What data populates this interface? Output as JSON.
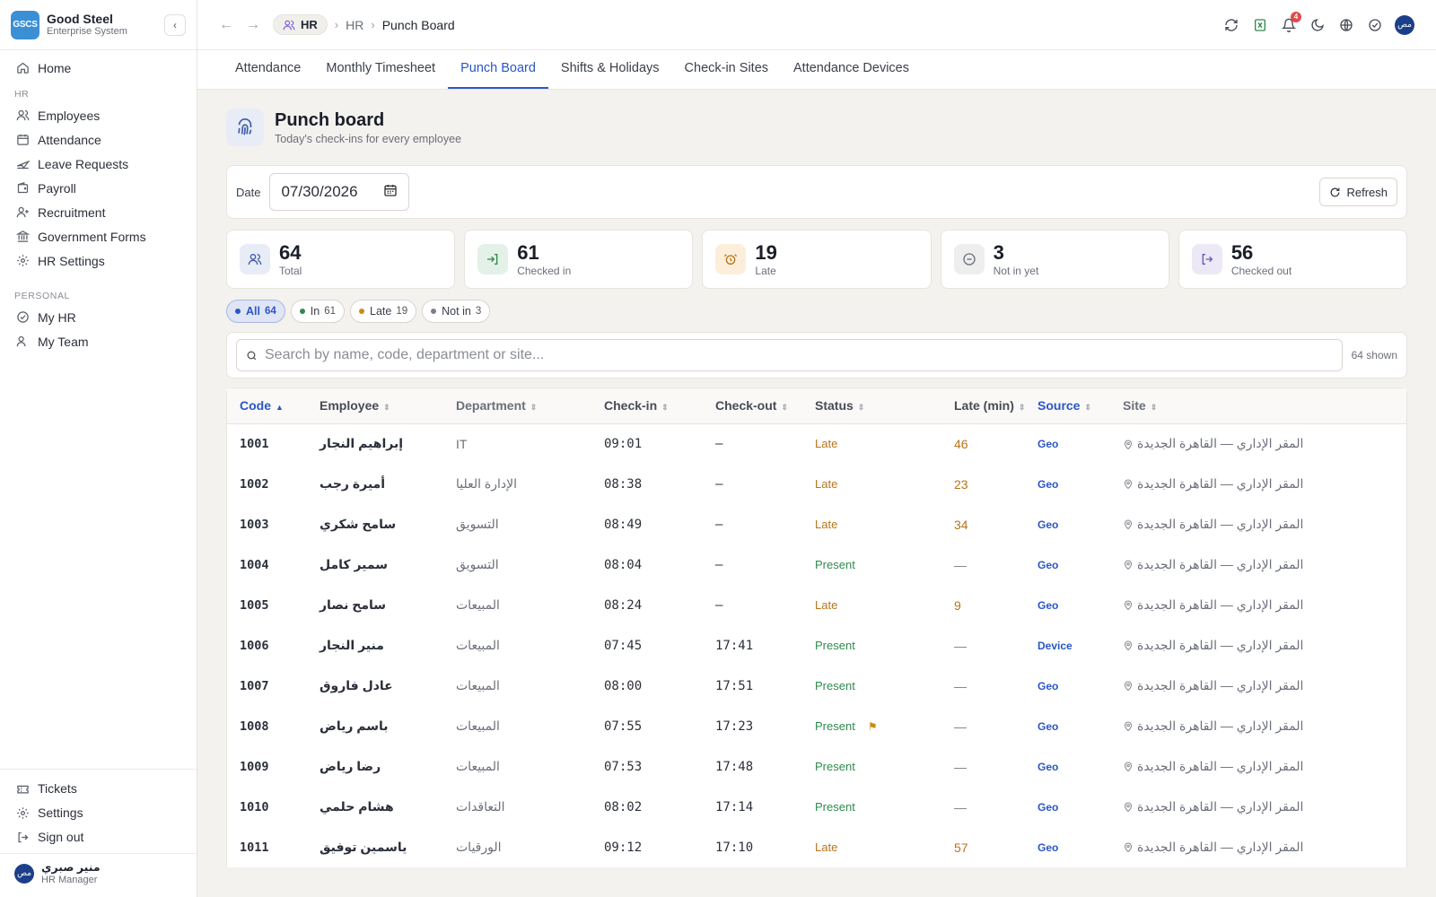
{
  "brand": {
    "logo": "GSCS",
    "name": "Good Steel",
    "subtitle": "Enterprise System"
  },
  "sidebar": {
    "home": "Home",
    "hr_section": "HR",
    "hr_items": [
      {
        "label": "Employees",
        "icon": "users-icon"
      },
      {
        "label": "Attendance",
        "icon": "calendar-icon"
      },
      {
        "label": "Leave Requests",
        "icon": "plane-icon"
      },
      {
        "label": "Payroll",
        "icon": "wallet-icon"
      },
      {
        "label": "Recruitment",
        "icon": "user-plus-icon"
      },
      {
        "label": "Government Forms",
        "icon": "landmark-icon"
      },
      {
        "label": "HR Settings",
        "icon": "gear-icon"
      }
    ],
    "personal_section": "PERSONAL",
    "personal_items": [
      {
        "label": "My HR",
        "icon": "check-circle-icon"
      },
      {
        "label": "My Team",
        "icon": "team-icon"
      }
    ],
    "bottom_items": [
      {
        "label": "Tickets",
        "icon": "ticket-icon"
      },
      {
        "label": "Settings",
        "icon": "gear-icon"
      },
      {
        "label": "Sign out",
        "icon": "sign-out-icon"
      }
    ],
    "user": {
      "initials": "مص",
      "name": "منير صبري",
      "role": "HR Manager"
    }
  },
  "topbar": {
    "module": "HR",
    "breadcrumbs": [
      "HR",
      "Punch Board"
    ],
    "notifications_count": "4",
    "avatar_initials": "مص"
  },
  "tabs": [
    "Attendance",
    "Monthly Timesheet",
    "Punch Board",
    "Shifts & Holidays",
    "Check-in Sites",
    "Attendance Devices"
  ],
  "active_tab": "Punch Board",
  "page": {
    "title": "Punch board",
    "subtitle": "Today's check-ins for every employee"
  },
  "filters": {
    "date_label": "Date",
    "date_value": "07/30/2026",
    "refresh_label": "Refresh"
  },
  "stats": [
    {
      "value": "64",
      "label": "Total",
      "color": "#e8ecf7",
      "fg": "#3c5aa8"
    },
    {
      "value": "61",
      "label": "Checked in",
      "color": "#e3f1e8",
      "fg": "#2f8a4d"
    },
    {
      "value": "19",
      "label": "Late",
      "color": "#fbeedb",
      "fg": "#b8741a"
    },
    {
      "value": "3",
      "label": "Not in yet",
      "color": "#eeeeee",
      "fg": "#6b6f7a"
    },
    {
      "value": "56",
      "label": "Checked out",
      "color": "#ece8f6",
      "fg": "#6b55b8"
    }
  ],
  "chips": [
    {
      "label": "All",
      "count": "64",
      "dot": "#2a56c6"
    },
    {
      "label": "In",
      "count": "61",
      "dot": "#2f8a4d"
    },
    {
      "label": "Late",
      "count": "19",
      "dot": "#c78d12"
    },
    {
      "label": "Not in",
      "count": "3",
      "dot": "#7b7f88"
    }
  ],
  "search": {
    "placeholder": "Search by name, code, department or site...",
    "shown_text": "64 shown"
  },
  "table": {
    "columns": [
      "Code",
      "Employee",
      "Department",
      "Check-in",
      "Check-out",
      "Status",
      "Late (min)",
      "Source",
      "Site"
    ],
    "rows": [
      {
        "code": "1001",
        "employee": "إبراهيم النجار",
        "department": "IT",
        "check_in": "09:01",
        "check_out": "—",
        "status": "Late",
        "late": "46",
        "source": "Geo",
        "site": "المقر الإداري — القاهرة الجديدة",
        "flag": false
      },
      {
        "code": "1002",
        "employee": "أميرة رجب",
        "department": "الإدارة العليا",
        "check_in": "08:38",
        "check_out": "—",
        "status": "Late",
        "late": "23",
        "source": "Geo",
        "site": "المقر الإداري — القاهرة الجديدة",
        "flag": false
      },
      {
        "code": "1003",
        "employee": "سامح شكري",
        "department": "التسويق",
        "check_in": "08:49",
        "check_out": "—",
        "status": "Late",
        "late": "34",
        "source": "Geo",
        "site": "المقر الإداري — القاهرة الجديدة",
        "flag": false
      },
      {
        "code": "1004",
        "employee": "سمير كامل",
        "department": "التسويق",
        "check_in": "08:04",
        "check_out": "—",
        "status": "Present",
        "late": "—",
        "source": "Geo",
        "site": "المقر الإداري — القاهرة الجديدة",
        "flag": false
      },
      {
        "code": "1005",
        "employee": "سامح نصار",
        "department": "المبيعات",
        "check_in": "08:24",
        "check_out": "—",
        "status": "Late",
        "late": "9",
        "source": "Geo",
        "site": "المقر الإداري — القاهرة الجديدة",
        "flag": false
      },
      {
        "code": "1006",
        "employee": "منير النجار",
        "department": "المبيعات",
        "check_in": "07:45",
        "check_out": "17:41",
        "status": "Present",
        "late": "—",
        "source": "Device",
        "site": "المقر الإداري — القاهرة الجديدة",
        "flag": false
      },
      {
        "code": "1007",
        "employee": "عادل فاروق",
        "department": "المبيعات",
        "check_in": "08:00",
        "check_out": "17:51",
        "status": "Present",
        "late": "—",
        "source": "Geo",
        "site": "المقر الإداري — القاهرة الجديدة",
        "flag": false
      },
      {
        "code": "1008",
        "employee": "باسم رياض",
        "department": "المبيعات",
        "check_in": "07:55",
        "check_out": "17:23",
        "status": "Present",
        "late": "—",
        "source": "Geo",
        "site": "المقر الإداري — القاهرة الجديدة",
        "flag": true
      },
      {
        "code": "1009",
        "employee": "رضا رياض",
        "department": "المبيعات",
        "check_in": "07:53",
        "check_out": "17:48",
        "status": "Present",
        "late": "—",
        "source": "Geo",
        "site": "المقر الإداري — القاهرة الجديدة",
        "flag": false
      },
      {
        "code": "1010",
        "employee": "هشام حلمي",
        "department": "التعاقدات",
        "check_in": "08:02",
        "check_out": "17:14",
        "status": "Present",
        "late": "—",
        "source": "Geo",
        "site": "المقر الإداري — القاهرة الجديدة",
        "flag": false
      },
      {
        "code": "1011",
        "employee": "ياسمين توفيق",
        "department": "الورقيات",
        "check_in": "09:12",
        "check_out": "17:10",
        "status": "Late",
        "late": "57",
        "source": "Geo",
        "site": "المقر الإداري — القاهرة الجديدة",
        "flag": false
      }
    ]
  }
}
